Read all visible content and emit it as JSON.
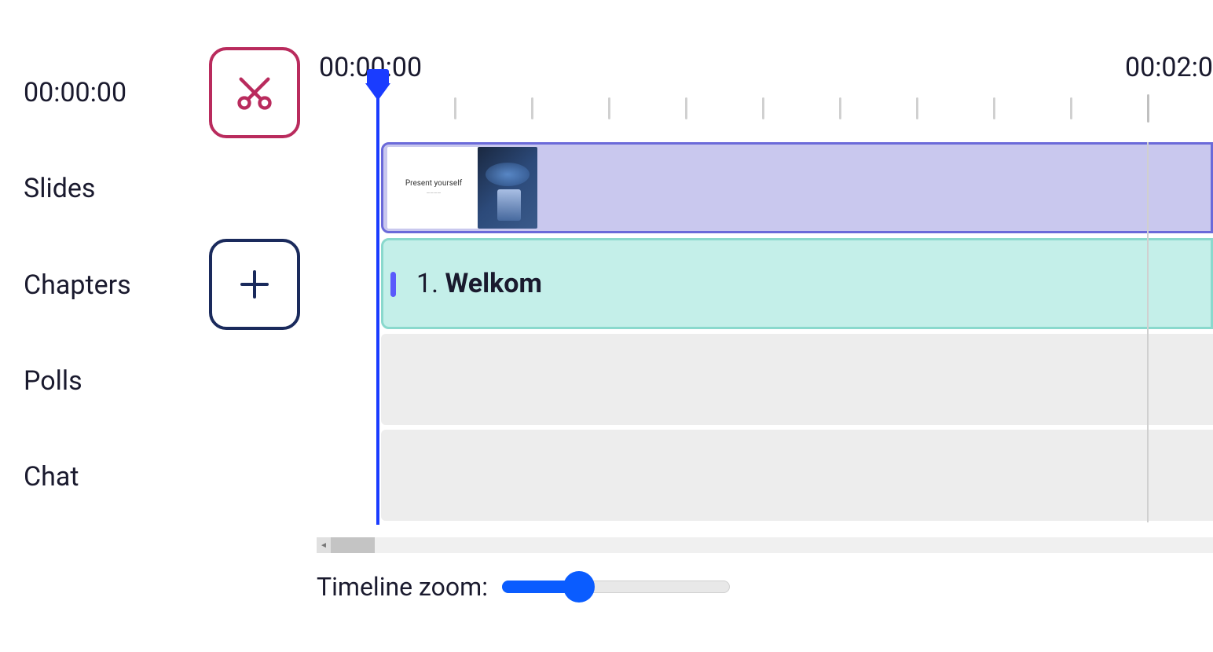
{
  "timeline": {
    "current_time": "00:00:00",
    "ruler_start": "00:00:00",
    "ruler_end": "00:02:0"
  },
  "rows": {
    "slides_label": "Slides",
    "chapters_label": "Chapters",
    "polls_label": "Polls",
    "chat_label": "Chat"
  },
  "slide": {
    "thumb_title": "Present yourself"
  },
  "chapter": {
    "index": "1.",
    "title": "Welkom"
  },
  "zoom": {
    "label": "Timeline zoom:",
    "value_percent": 30
  },
  "icons": {
    "cut": "scissors-icon",
    "add": "plus-icon"
  },
  "colors": {
    "accent_blue": "#1a3cff",
    "cut_border": "#b92b5d",
    "add_border": "#1a2a5c",
    "slides_bg": "#c9c8ee",
    "chapters_bg": "#c4efe9"
  }
}
